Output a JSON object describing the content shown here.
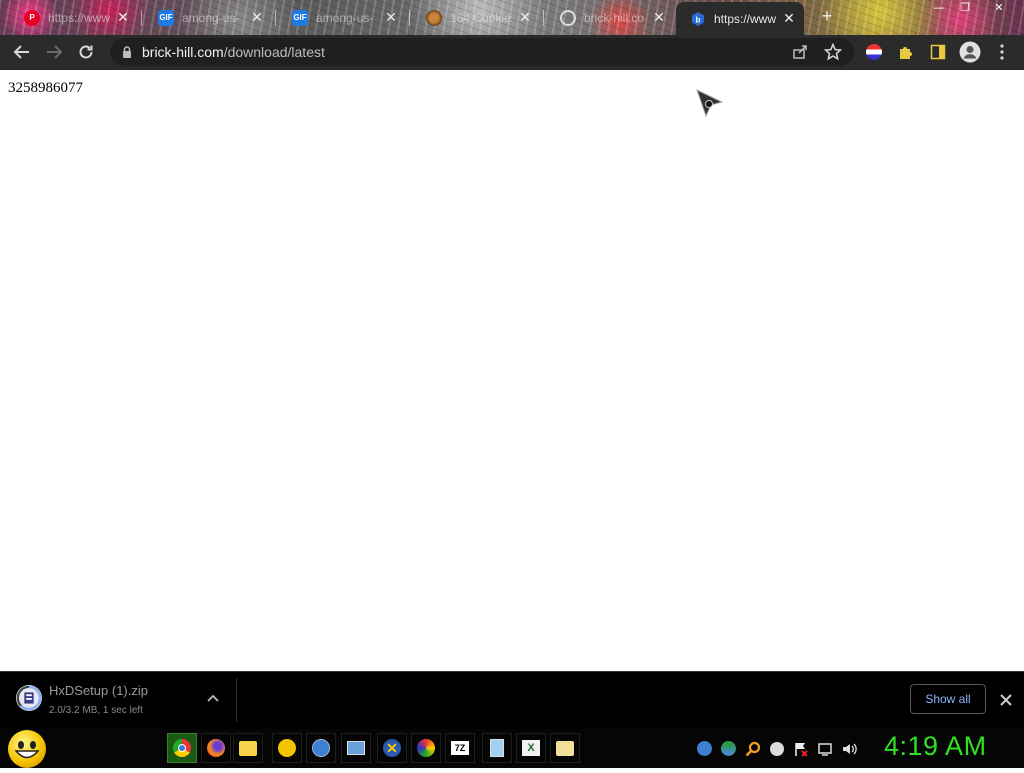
{
  "browser": {
    "tabs": [
      {
        "title": "https://www.",
        "icon": "pinterest-icon",
        "active": false
      },
      {
        "title": "among-us-",
        "icon": "gif-icon",
        "active": false
      },
      {
        "title": "among-us-",
        "icon": "gif-icon",
        "active": false
      },
      {
        "title": "164 Cookies",
        "icon": "cookie-icon",
        "active": false
      },
      {
        "title": "brick-hill.co",
        "icon": "google-icon",
        "active": false
      },
      {
        "title": "https://www.",
        "icon": "brick-hill-icon",
        "active": true
      }
    ],
    "gif_label": "GIF",
    "new_tab_label": "+",
    "url_host": "brick-hill.com",
    "url_path": "/download/latest"
  },
  "page": {
    "text": "3258986077"
  },
  "download_bar": {
    "file_name": "HxDSetup (1).zip",
    "status": "2.0/3.2 MB, 1 sec left",
    "show_all_label": "Show all",
    "progress_fraction": 0.625
  },
  "taskbar": {
    "apps": [
      "chrome-icon",
      "firefox-icon",
      "file-manager-icon",
      "emoji-app-icon",
      "qbittorrent-icon",
      "screenshot-icon",
      "xnview-icon",
      "paint-icon",
      "7zip-icon",
      "notepad-icon",
      "excel-icon",
      "folder-icon"
    ],
    "seven_zip_label": "7Z",
    "clock": "4:19 AM"
  },
  "colors": {
    "toolbar": "#2b2b2b",
    "download_bar": "#000000",
    "clock": "#31e020",
    "show_all_text": "#8ab4f8"
  }
}
